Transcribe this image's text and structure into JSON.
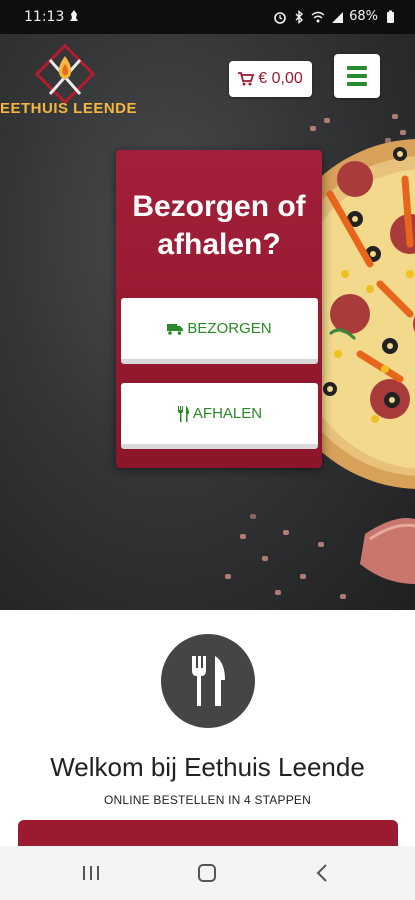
{
  "status_bar": {
    "time": "11:13",
    "battery": "68%",
    "icons": [
      "alarm-icon",
      "bluetooth-icon",
      "wifi-icon",
      "signal-icon",
      "battery-icon"
    ]
  },
  "header": {
    "logo_text": "EETHUIS LEENDE",
    "cart_total": "€ 0,00",
    "menu_icon": "hamburger-icon"
  },
  "order_type_modal": {
    "title": "Bezorgen of afhalen?",
    "deliver_label": "BEZORGEN",
    "pickup_label": "AFHALEN"
  },
  "intro": {
    "welcome": "Welkom bij Eethuis Leende",
    "subtitle": "ONLINE BESTELLEN IN 4 STAPPEN"
  },
  "colors": {
    "brand_red": "#9a1a2f",
    "accent_green": "#2a8a2a",
    "logo_gold": "#f5b640"
  }
}
